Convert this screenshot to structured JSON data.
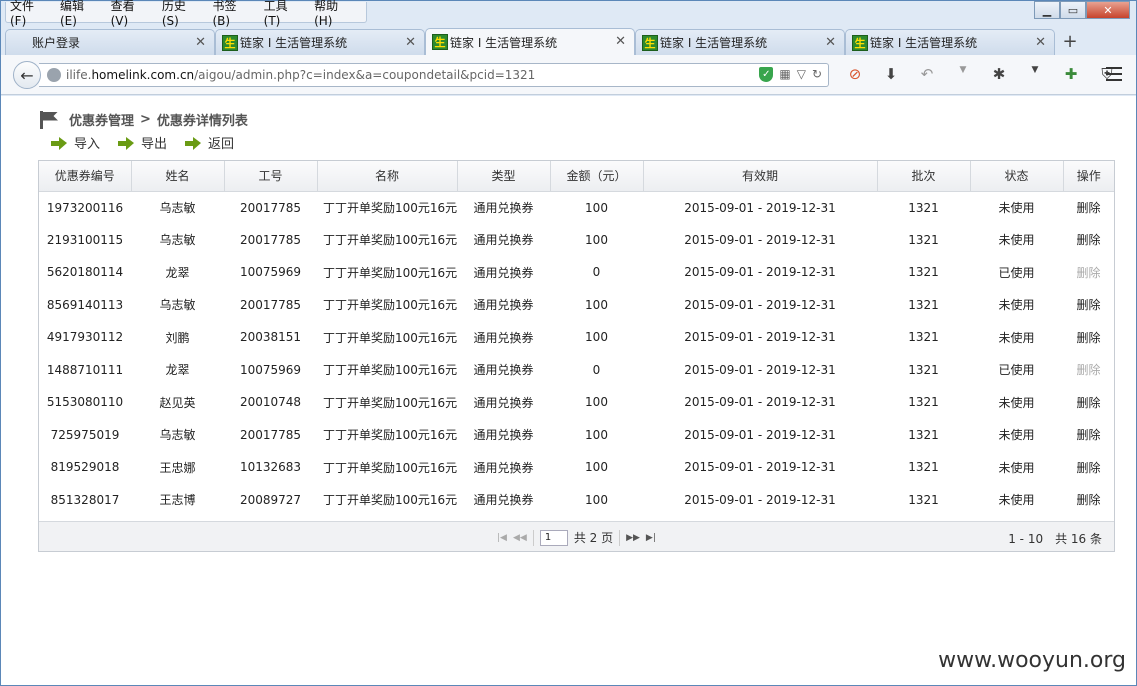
{
  "menu": [
    "文件(F)",
    "编辑(E)",
    "查看(V)",
    "历史(S)",
    "书签(B)",
    "工具(T)",
    "帮助(H)"
  ],
  "tabs": [
    {
      "label": "账户登录",
      "active": false,
      "favicon": ""
    },
    {
      "label": "链家 I 生活管理系统",
      "active": false,
      "favicon": "生"
    },
    {
      "label": "链家 I 生活管理系统",
      "active": true,
      "favicon": "生"
    },
    {
      "label": "链家 I 生活管理系统",
      "active": false,
      "favicon": "生"
    },
    {
      "label": "链家 I 生活管理系统",
      "active": false,
      "favicon": "生"
    }
  ],
  "url": {
    "prefix": "ilife.",
    "host": "homelink.com.cn",
    "path": "/aigou/admin.php?c=index&a=coupondetail&pcid=1321"
  },
  "breadcrumb": {
    "parent": "优惠券管理",
    "separator": ">",
    "current": "优惠券详情列表"
  },
  "actions": {
    "import": "导入",
    "export": "导出",
    "back": "返回"
  },
  "table": {
    "headers": [
      "优惠券编号",
      "姓名",
      "工号",
      "名称",
      "类型",
      "金额（元）",
      "有效期",
      "批次",
      "状态",
      "操作"
    ],
    "rows": [
      {
        "id": "1973200116",
        "name": "乌志敏",
        "emp": "20017785",
        "title": "丁丁开单奖励100元16元",
        "type": "通用兑换券",
        "amount": "100",
        "valid": "2015-09-01 - 2019-12-31",
        "batch": "1321",
        "status": "未使用",
        "op": "删除",
        "op_enabled": true
      },
      {
        "id": "2193100115",
        "name": "乌志敏",
        "emp": "20017785",
        "title": "丁丁开单奖励100元16元",
        "type": "通用兑换券",
        "amount": "100",
        "valid": "2015-09-01 - 2019-12-31",
        "batch": "1321",
        "status": "未使用",
        "op": "删除",
        "op_enabled": true
      },
      {
        "id": "5620180114",
        "name": "龙翠",
        "emp": "10075969",
        "title": "丁丁开单奖励100元16元",
        "type": "通用兑换券",
        "amount": "0",
        "valid": "2015-09-01 - 2019-12-31",
        "batch": "1321",
        "status": "已使用",
        "op": "删除",
        "op_enabled": false
      },
      {
        "id": "8569140113",
        "name": "乌志敏",
        "emp": "20017785",
        "title": "丁丁开单奖励100元16元",
        "type": "通用兑换券",
        "amount": "100",
        "valid": "2015-09-01 - 2019-12-31",
        "batch": "1321",
        "status": "未使用",
        "op": "删除",
        "op_enabled": true
      },
      {
        "id": "4917930112",
        "name": "刘鹏",
        "emp": "20038151",
        "title": "丁丁开单奖励100元16元",
        "type": "通用兑换券",
        "amount": "100",
        "valid": "2015-09-01 - 2019-12-31",
        "batch": "1321",
        "status": "未使用",
        "op": "删除",
        "op_enabled": true
      },
      {
        "id": "1488710111",
        "name": "龙翠",
        "emp": "10075969",
        "title": "丁丁开单奖励100元16元",
        "type": "通用兑换券",
        "amount": "0",
        "valid": "2015-09-01 - 2019-12-31",
        "batch": "1321",
        "status": "已使用",
        "op": "删除",
        "op_enabled": false
      },
      {
        "id": "5153080110",
        "name": "赵见英",
        "emp": "20010748",
        "title": "丁丁开单奖励100元16元",
        "type": "通用兑换券",
        "amount": "100",
        "valid": "2015-09-01 - 2019-12-31",
        "batch": "1321",
        "status": "未使用",
        "op": "删除",
        "op_enabled": true
      },
      {
        "id": "725975019",
        "name": "乌志敏",
        "emp": "20017785",
        "title": "丁丁开单奖励100元16元",
        "type": "通用兑换券",
        "amount": "100",
        "valid": "2015-09-01 - 2019-12-31",
        "batch": "1321",
        "status": "未使用",
        "op": "删除",
        "op_enabled": true
      },
      {
        "id": "819529018",
        "name": "王忠娜",
        "emp": "10132683",
        "title": "丁丁开单奖励100元16元",
        "type": "通用兑换券",
        "amount": "100",
        "valid": "2015-09-01 - 2019-12-31",
        "batch": "1321",
        "status": "未使用",
        "op": "删除",
        "op_enabled": true
      },
      {
        "id": "851328017",
        "name": "王志博",
        "emp": "20089727",
        "title": "丁丁开单奖励100元16元",
        "type": "通用兑换券",
        "amount": "100",
        "valid": "2015-09-01 - 2019-12-31",
        "batch": "1321",
        "status": "未使用",
        "op": "删除",
        "op_enabled": true
      }
    ]
  },
  "pager": {
    "page": "1",
    "total_pages": "共 2 页",
    "range": "1 - 10　共 16 条"
  },
  "watermark": "www.wooyun.org"
}
